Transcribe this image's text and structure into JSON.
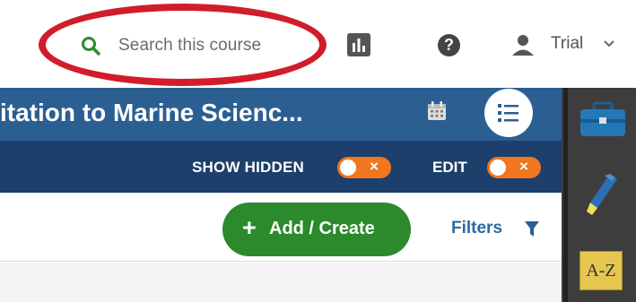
{
  "topbar": {
    "search_label": "Search this course",
    "user_name": "Trial"
  },
  "course": {
    "title": "itation to Marine Scienc..."
  },
  "subbar": {
    "show_hidden_label": "SHOW HIDDEN",
    "edit_label": "EDIT",
    "toggle_x": "×"
  },
  "actions": {
    "add_create_label": "Add / Create",
    "add_plus": "+",
    "filters_label": "Filters"
  },
  "rail": {
    "az_label": "A-Z"
  },
  "colors": {
    "course_bar": "#2b5f92",
    "sub_bar": "#1d3f6b",
    "toggle_orange": "#f0761f",
    "add_green": "#2b8a2b",
    "highlight_red": "#d11d2a"
  },
  "icons": [
    "search-icon",
    "analytics-icon",
    "help-icon",
    "user-icon",
    "chevron-down-icon",
    "calendar-icon",
    "list-icon",
    "filter-icon",
    "briefcase-icon",
    "highlighter-icon",
    "glossary-az-icon"
  ]
}
